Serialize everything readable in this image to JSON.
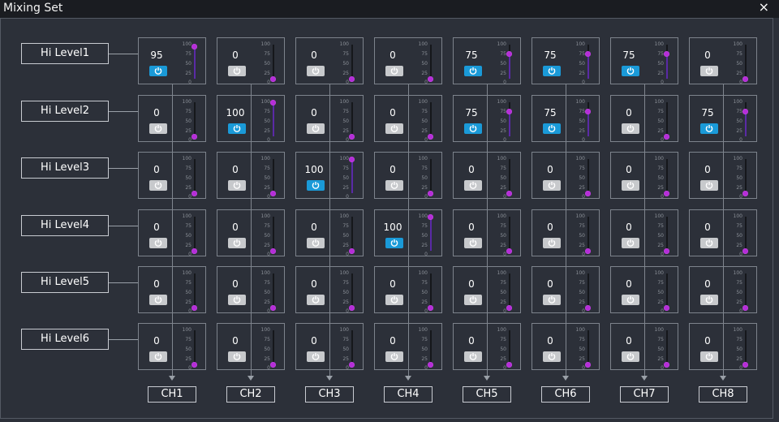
{
  "window": {
    "title": "Mixing Set",
    "close_glyph": "×"
  },
  "rows": [
    {
      "label": "Hi Level1",
      "cells": [
        {
          "value": 95,
          "on": true
        },
        {
          "value": 0,
          "on": false
        },
        {
          "value": 0,
          "on": false
        },
        {
          "value": 0,
          "on": false
        },
        {
          "value": 75,
          "on": true
        },
        {
          "value": 75,
          "on": true
        },
        {
          "value": 75,
          "on": true
        },
        {
          "value": 0,
          "on": false
        }
      ]
    },
    {
      "label": "Hi Level2",
      "cells": [
        {
          "value": 0,
          "on": false
        },
        {
          "value": 100,
          "on": true
        },
        {
          "value": 0,
          "on": false
        },
        {
          "value": 0,
          "on": false
        },
        {
          "value": 75,
          "on": true
        },
        {
          "value": 75,
          "on": true
        },
        {
          "value": 0,
          "on": false
        },
        {
          "value": 75,
          "on": true
        }
      ]
    },
    {
      "label": "Hi Level3",
      "cells": [
        {
          "value": 0,
          "on": false
        },
        {
          "value": 0,
          "on": false
        },
        {
          "value": 100,
          "on": true
        },
        {
          "value": 0,
          "on": false
        },
        {
          "value": 0,
          "on": false
        },
        {
          "value": 0,
          "on": false
        },
        {
          "value": 0,
          "on": false
        },
        {
          "value": 0,
          "on": false
        }
      ]
    },
    {
      "label": "Hi Level4",
      "cells": [
        {
          "value": 0,
          "on": false
        },
        {
          "value": 0,
          "on": false
        },
        {
          "value": 0,
          "on": false
        },
        {
          "value": 100,
          "on": true
        },
        {
          "value": 0,
          "on": false
        },
        {
          "value": 0,
          "on": false
        },
        {
          "value": 0,
          "on": false
        },
        {
          "value": 0,
          "on": false
        }
      ]
    },
    {
      "label": "Hi Level5",
      "cells": [
        {
          "value": 0,
          "on": false
        },
        {
          "value": 0,
          "on": false
        },
        {
          "value": 0,
          "on": false
        },
        {
          "value": 0,
          "on": false
        },
        {
          "value": 0,
          "on": false
        },
        {
          "value": 0,
          "on": false
        },
        {
          "value": 0,
          "on": false
        },
        {
          "value": 0,
          "on": false
        }
      ]
    },
    {
      "label": "Hi Level6",
      "cells": [
        {
          "value": 0,
          "on": false
        },
        {
          "value": 0,
          "on": false
        },
        {
          "value": 0,
          "on": false
        },
        {
          "value": 0,
          "on": false
        },
        {
          "value": 0,
          "on": false
        },
        {
          "value": 0,
          "on": false
        },
        {
          "value": 0,
          "on": false
        },
        {
          "value": 0,
          "on": false
        }
      ]
    }
  ],
  "channels": [
    "CH1",
    "CH2",
    "CH3",
    "CH4",
    "CH5",
    "CH6",
    "CH7",
    "CH8"
  ],
  "scale_ticks": [
    "100",
    "75",
    "50",
    "25",
    "0"
  ],
  "colors": {
    "button_on": "#1a9ad8",
    "button_off": "#c7c9cc",
    "slider_fill": "#5a2aa6",
    "slider_knob": "#b52ed8"
  },
  "icons": {
    "button": "power-icon",
    "channel_arrow": "arrow-down-icon",
    "close": "close-icon"
  }
}
